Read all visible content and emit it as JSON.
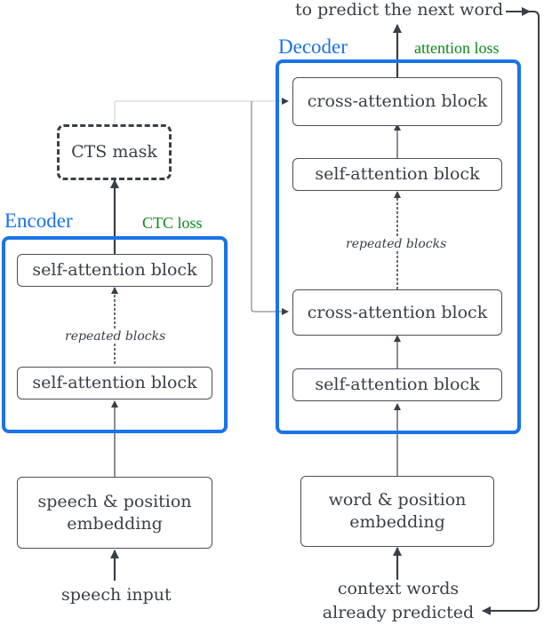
{
  "diagram": {
    "top_output": "to predict the next word",
    "encoder": {
      "title": "Encoder",
      "loss": "CTC loss",
      "blocks": [
        "self-attention block",
        "self-attention block"
      ],
      "repeat_label": "repeated blocks"
    },
    "decoder": {
      "title": "Decoder",
      "loss": "attention loss",
      "blocks": [
        "cross-attention block",
        "self-attention block",
        "cross-attention block",
        "self-attention block"
      ],
      "repeat_label": "repeated blocks"
    },
    "cts_mask": "CTS mask",
    "speech_embedding": "speech & position embedding",
    "word_embedding": "word & position embedding",
    "speech_input": "speech input",
    "context_words": "context words already predicted",
    "colors": {
      "group_border": "#1a73e8",
      "loss_text": "#0a8a16",
      "line": "#3a3f47"
    }
  }
}
